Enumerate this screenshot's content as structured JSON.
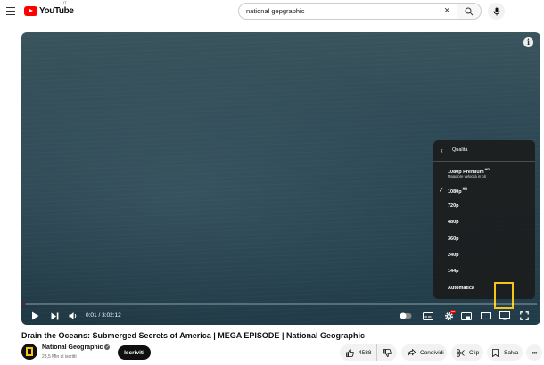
{
  "header": {
    "logo_text": "YouTube",
    "logo_country": "IT",
    "search_value": "national gepgraphic",
    "icons": [
      "menu-icon",
      "search-icon",
      "clear-icon",
      "mic-icon"
    ]
  },
  "player": {
    "time_display": "0:01 / 3:02:12",
    "progress": 0.0001,
    "accent_color": "#ff0000",
    "quality_menu": {
      "title": "Qualità",
      "items": [
        {
          "label": "1080p Premium",
          "badge": "HD",
          "sub": "Maggiore velocità in bit",
          "selected": false
        },
        {
          "label": "1080p",
          "badge": "HD",
          "sub": "",
          "selected": true
        },
        {
          "label": "720p",
          "badge": "",
          "sub": "",
          "selected": false
        },
        {
          "label": "480p",
          "badge": "",
          "sub": "",
          "selected": false
        },
        {
          "label": "360p",
          "badge": "",
          "sub": "",
          "selected": false
        },
        {
          "label": "240p",
          "badge": "",
          "sub": "",
          "selected": false
        },
        {
          "label": "144p",
          "badge": "",
          "sub": "",
          "selected": false
        },
        {
          "label": "Automatica",
          "badge": "",
          "sub": "",
          "selected": false
        }
      ]
    },
    "settings_badge": "HD"
  },
  "video": {
    "title": "Drain the Oceans: Submerged Secrets of America | MEGA EPISODE | National Geographic",
    "channel": "National Geographic",
    "subscribers": "23,5 Mln di iscritti",
    "subscribe_label": "Iscriviti",
    "likes": "4588",
    "share_label": "Condividi",
    "clip_label": "Clip",
    "save_label": "Salva"
  }
}
